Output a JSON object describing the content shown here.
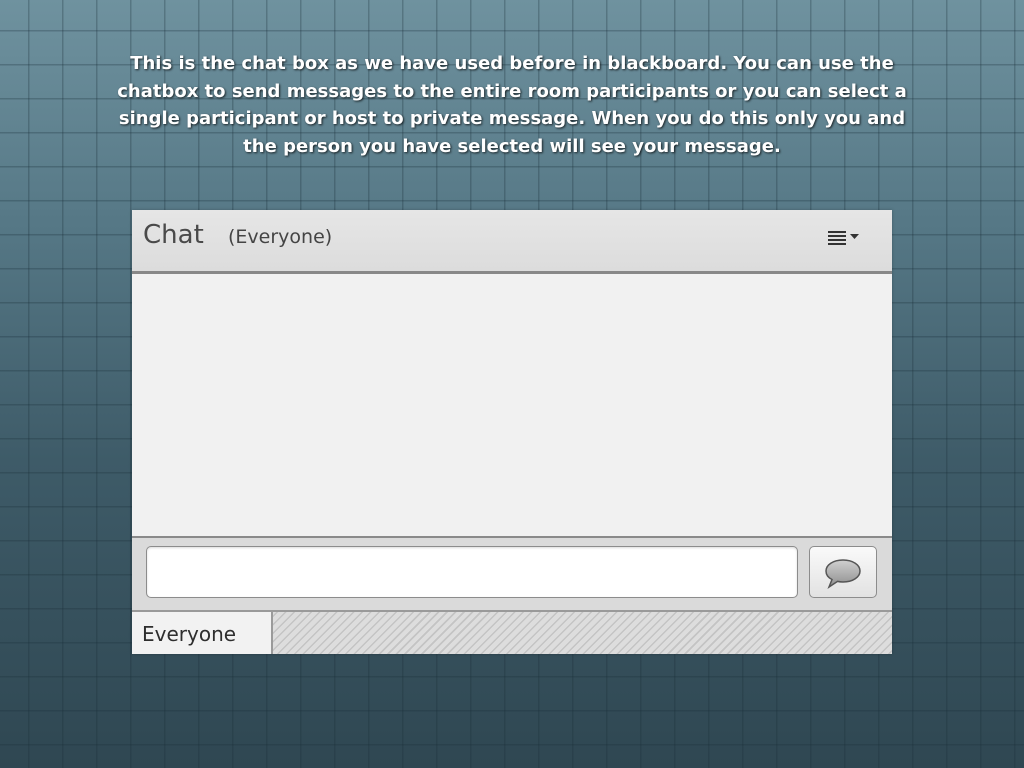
{
  "slide": {
    "caption": "This is the chat box as we have used before in blackboard.  You can use the chatbox to send messages to the entire room participants or you can select a single participant or host to private message.  When you do this only you and the person you have selected will see your message."
  },
  "chat": {
    "title": "Chat",
    "scope": "(Everyone)",
    "menu_icon": "list-menu-dropdown-icon",
    "input": {
      "value": "",
      "placeholder": ""
    },
    "send_icon": "speech-bubble-icon",
    "tabs": [
      {
        "label": "Everyone"
      }
    ]
  }
}
